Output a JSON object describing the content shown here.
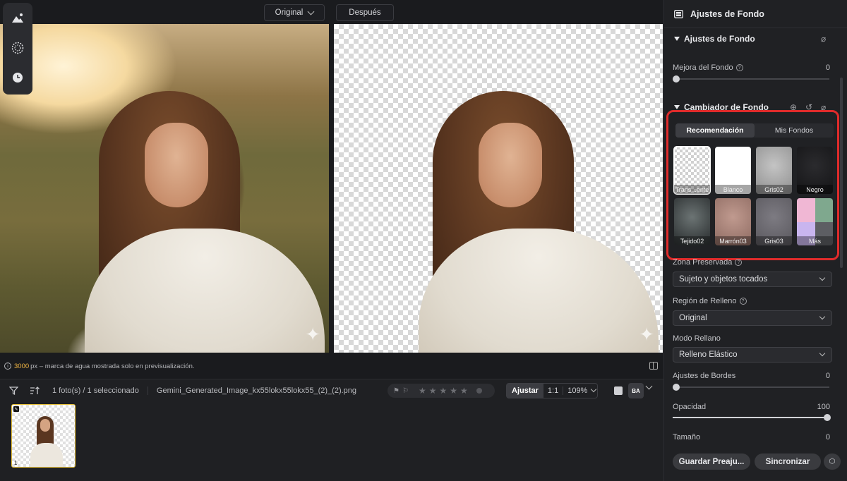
{
  "canvas": {
    "view_mode": "Original",
    "after_label": "Después",
    "info_px": "3000",
    "info_text": "px – marca de agua mostrada solo en previsualización."
  },
  "tools": [
    "object-layer-icon",
    "texture-icon",
    "history-icon"
  ],
  "filmstrip": {
    "photo_count": "1 foto(s) / 1 seleccionado",
    "file_name": "Gemini_Generated_Image_kx55lokx55lokx55_(2)_(2).png",
    "zoom_fit": "Ajustar",
    "zoom_one": "1:1",
    "zoom_level": "109%",
    "compare_badge": "BA",
    "thumb_number": "1"
  },
  "panel": {
    "title": "Ajustes de Fondo",
    "section_adjust": "Ajustes de Fondo",
    "enhance_label": "Mejora del Fondo",
    "enhance_value": "0",
    "section_changer": "Cambiador de Fondo",
    "tabs": [
      "Recomendación",
      "Mis Fondos"
    ],
    "swatches": [
      {
        "label": "Trans...ente",
        "color": "transparent"
      },
      {
        "label": "Blanco",
        "color": "#ffffff"
      },
      {
        "label": "Gris02",
        "color": "#a8a8a8"
      },
      {
        "label": "Negro",
        "color": "#1c1c1e"
      },
      {
        "label": "Tejido02",
        "color": "#4b5152"
      },
      {
        "label": "Marrón03",
        "color": "#a47c73"
      },
      {
        "label": "Gris03",
        "color": "#6c6a70"
      },
      {
        "label": "Más",
        "color": "#e8b6d2"
      }
    ],
    "preserved_label": "Zona Preservada",
    "preserved_value": "Sujeto y objetos tocados",
    "fill_region_label": "Región de Relleno",
    "fill_region_value": "Original",
    "fill_mode_label": "Modo Rellano",
    "fill_mode_value": "Relleno Elástico",
    "edge_label": "Ajustes de Bordes",
    "edge_value": "0",
    "opacity_label": "Opacidad",
    "opacity_value": "100",
    "size_label": "Tamaño",
    "size_value": "0",
    "save_preset": "Guardar Preaju...",
    "sync": "Sincronizar"
  }
}
